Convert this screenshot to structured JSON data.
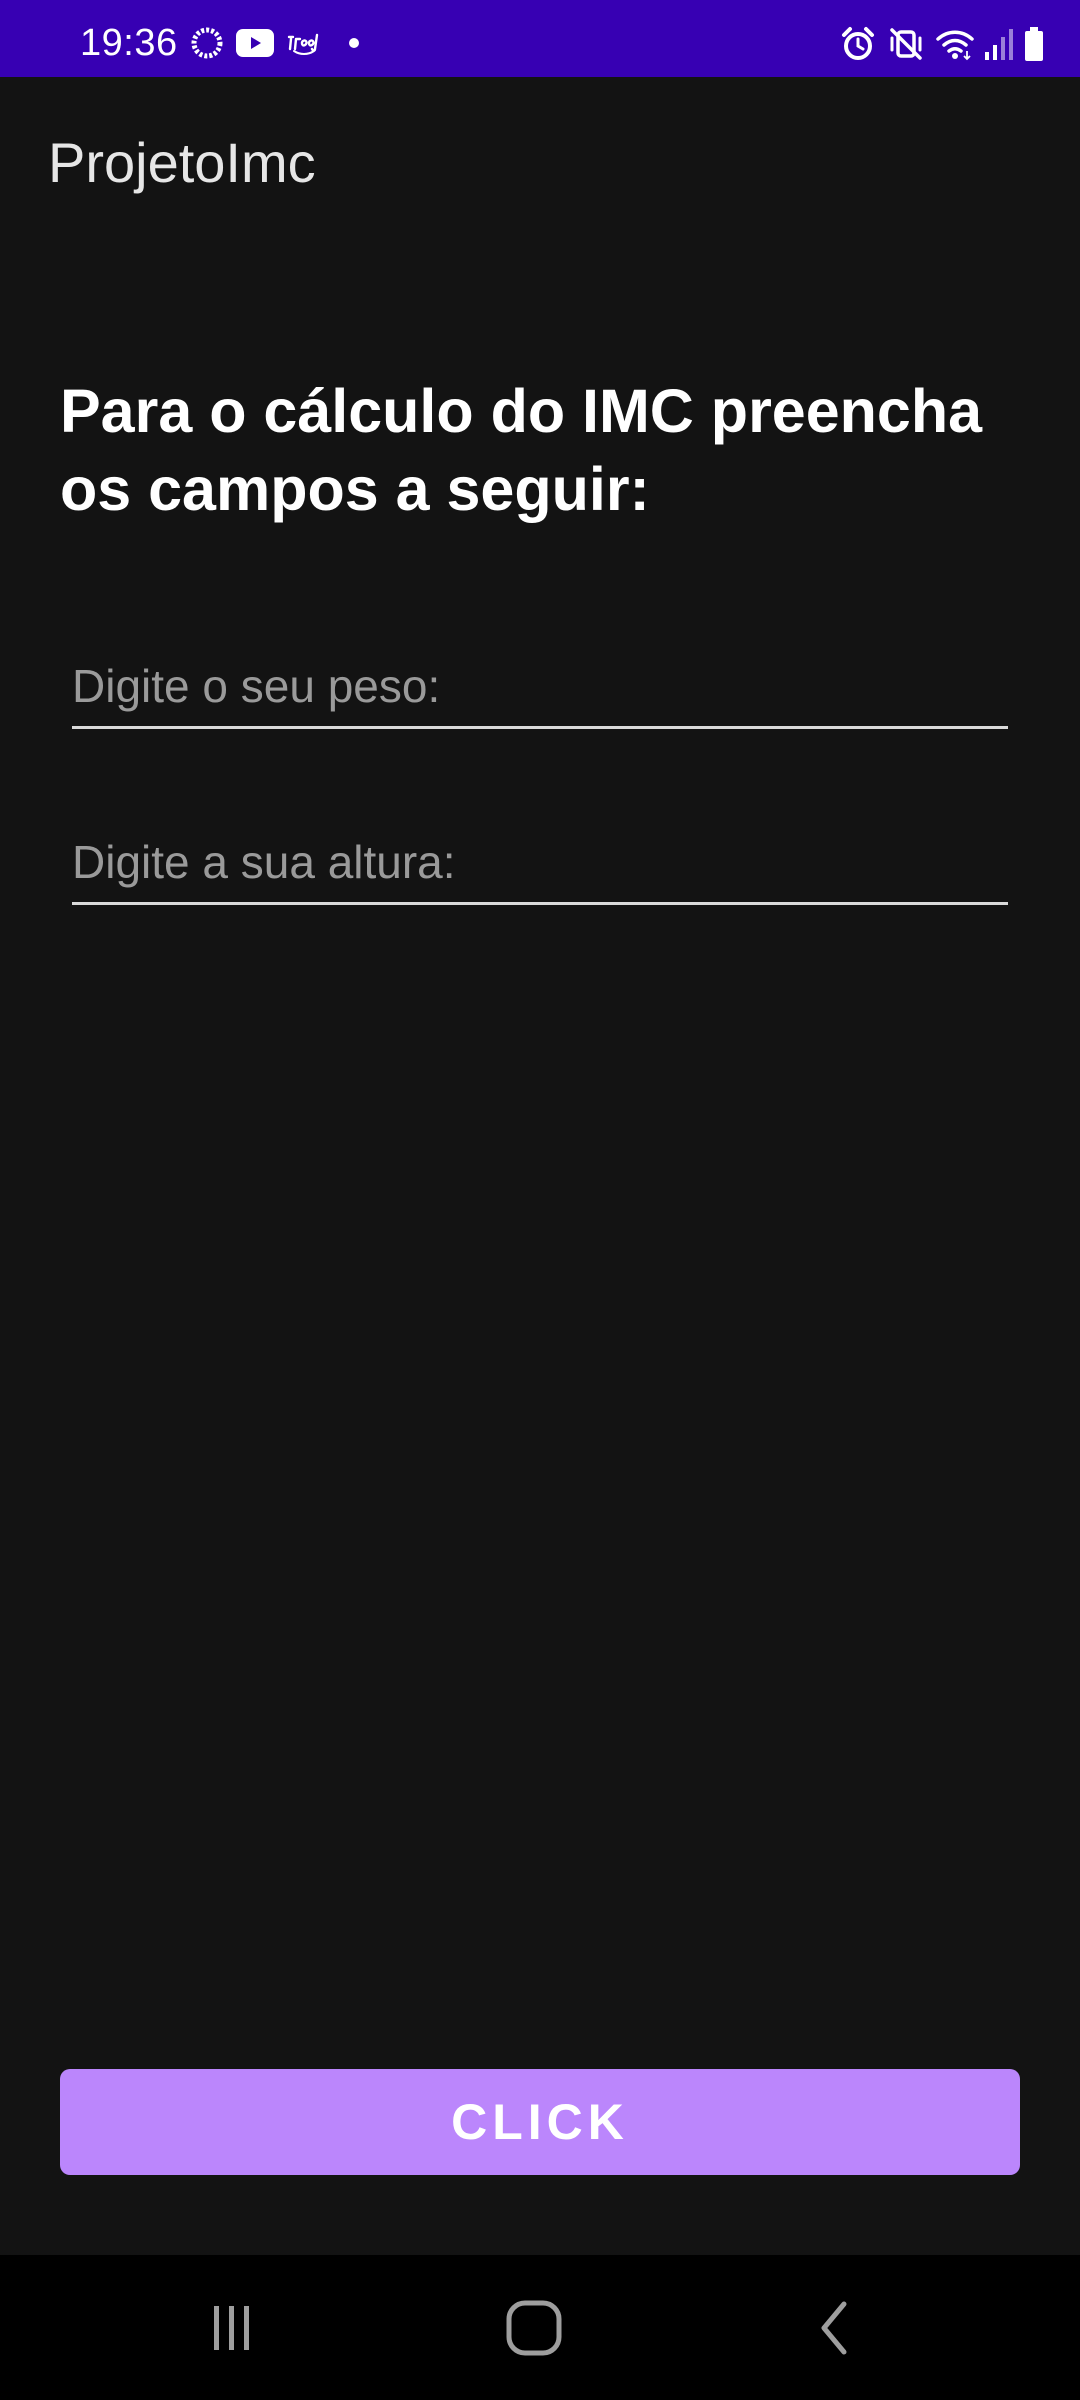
{
  "status_bar": {
    "time": "19:36",
    "background": "#3700b3",
    "left_icons": [
      "loading-circle-icon",
      "youtube-icon",
      "ifood-icon",
      "dot-icon"
    ],
    "right_icons": [
      "alarm-icon",
      "vibrate-mute-icon",
      "wifi-icon",
      "signal-icon",
      "battery-icon"
    ]
  },
  "app_bar": {
    "title": "ProjetoImc"
  },
  "main": {
    "instructions": "Para o cálculo do IMC preencha os campos a seguir:",
    "weight_field": {
      "value": "",
      "placeholder": "Digite o seu peso:"
    },
    "height_field": {
      "value": "",
      "placeholder": "Digite a sua altura:"
    },
    "button_label": "CLICK",
    "accent_color": "#bb86fc"
  },
  "nav_bar": {
    "icons": [
      "recent-apps-icon",
      "home-icon",
      "back-icon"
    ]
  }
}
